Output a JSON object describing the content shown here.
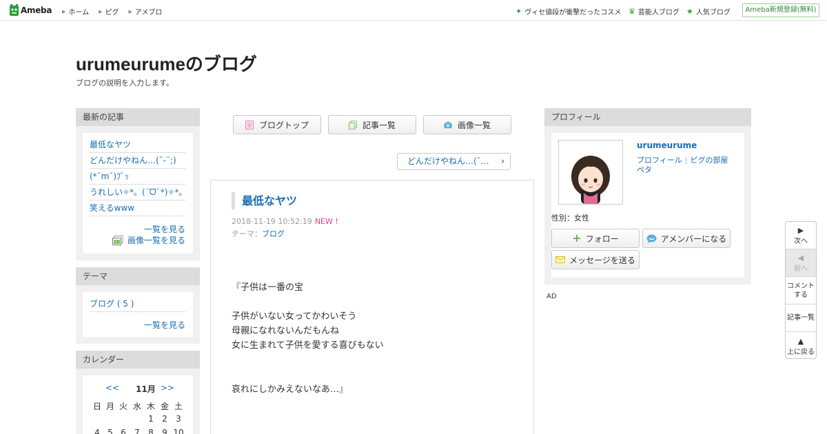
{
  "header": {
    "logo": "Ameba",
    "nav": [
      "ホーム",
      "ピグ",
      "アメブロ"
    ],
    "promos": [
      {
        "icon": "sparkle-icon",
        "label": "ヴィセ値段が衝撃だったコスメ"
      },
      {
        "icon": "crown-icon",
        "label": "芸能人ブログ"
      },
      {
        "icon": "star-icon",
        "label": "人気ブログ"
      }
    ],
    "register": "Ameba新規登録(無料)",
    "accent": "#2d9d3a"
  },
  "blog": {
    "title": "urumeurumeのブログ",
    "description": "ブログの説明を入力します。"
  },
  "sidebar_left": {
    "recent": {
      "heading": "最新の記事",
      "items": [
        "最低なヤツ",
        "どんだけやねん…(¯-¯;)",
        "(*¯m¯)ﾌﾟｯ",
        "うれしい✧*。(ˊᗜˋ*)✧*。",
        "笑えるwww"
      ],
      "more": "一覧を見る",
      "image_list": "画像一覧を見る"
    },
    "theme": {
      "heading": "テーマ",
      "items": [
        "ブログ ( 5 )"
      ],
      "more": "一覧を見る"
    },
    "calendar": {
      "heading": "カレンダー",
      "prev": "<<",
      "month": "11月",
      "next": ">>",
      "weekdays": [
        "日",
        "月",
        "火",
        "水",
        "木",
        "金",
        "土"
      ],
      "row1": [
        "1",
        "2",
        "3"
      ],
      "row2": [
        "4",
        "5",
        "6",
        "7",
        "8",
        "9",
        "10"
      ]
    }
  },
  "center": {
    "buttons": {
      "blog_top": "ブログトップ",
      "entry_list": "記事一覧",
      "image_list": "画像一覧"
    },
    "prev_entry": "どんだけやねん…(¯…",
    "entry": {
      "title": "最低なヤツ",
      "date": "2018-11-19 10:52:19",
      "new_badge": "NEW !",
      "theme_label": "テーマ：",
      "theme_value": "ブログ",
      "lines": [
        "『子供は一番の宝",
        "子供がいない女ってかわいそう",
        "母親になれないんだもんね",
        "女に生まれて子供を愛する喜びもない",
        "哀れにしかみえないなあ…』"
      ]
    }
  },
  "profile": {
    "heading": "プロフィール",
    "name": "urumeurume",
    "links": [
      "プロフィール",
      "ピグの部屋",
      "ペタ"
    ],
    "separator": "|",
    "gender": "性別：女性",
    "follow": "フォロー",
    "amember": "アメンバーになる",
    "message": "メッセージを送る",
    "ad": "AD"
  },
  "floatnav": {
    "next": "次へ",
    "prev": "前へ",
    "comment_1": "コメント",
    "comment_2": "する",
    "list": "記事一覧",
    "top": "上に戻る"
  }
}
